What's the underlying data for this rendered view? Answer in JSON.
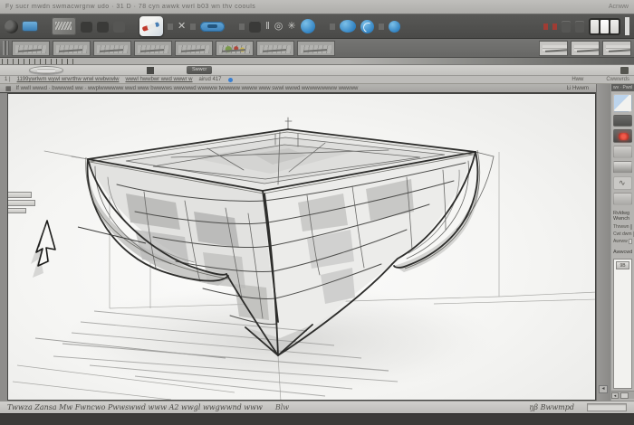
{
  "colors": {
    "accent_blue": "#3f8fc8",
    "record_red": "#c4392e",
    "canvas_bg": "#f6f6f4",
    "toolbar_dark": "#4e4e4c",
    "bottom_bar": "#3b3a38"
  },
  "icons": {
    "pause": "‖",
    "ring": "◎",
    "star": "✳",
    "left_arrow": "◂",
    "window": "▦"
  },
  "menu_bar": {
    "text": "Fy sucr  mwdn swmacwrgnw udo  · 31 D · 78 cyn awwk vwrl b03 wn thv coouls",
    "right_text": "Acnww"
  },
  "quick_bar": {
    "button_label": "Swwcr"
  },
  "address_bar": {
    "prefix": "1 |",
    "segment_1": "1199ywrlwm wywl wrwrthw wrwl wwbwwlw",
    "segment_2": "wwwl hwwbwr wwd wwwr w",
    "zoom_value": "airud 417",
    "right_1": "Hww",
    "right_2": "Cwwwrds"
  },
  "viewport": {
    "title": "If wwll wwwd · bwwwwd ww · wwplwwwwww wwd www bwwwws wwwwwd wwwww twwwww wwww www swwl wwwd wwwwwwwww wwwww",
    "title_right": "Ŀi Hwwm"
  },
  "right_panel": {
    "header": "wv · Pwnl",
    "section_label": "Rvldwg Wwnch",
    "fields": [
      {
        "label": "Thrwwn"
      },
      {
        "label": "Cwt dwm"
      },
      {
        "label": "Awrww"
      }
    ],
    "advanced_label": "Awwcwd",
    "list_button": "9B"
  },
  "status_bar": {
    "left_text": "Twwza   Zansa   Mw   Fwncwo   Pwwswwd   www   A2 wwgl   wwgwwnd   www",
    "mid_text": "Blw",
    "right_text": "ŋβ Bwwmpd"
  }
}
